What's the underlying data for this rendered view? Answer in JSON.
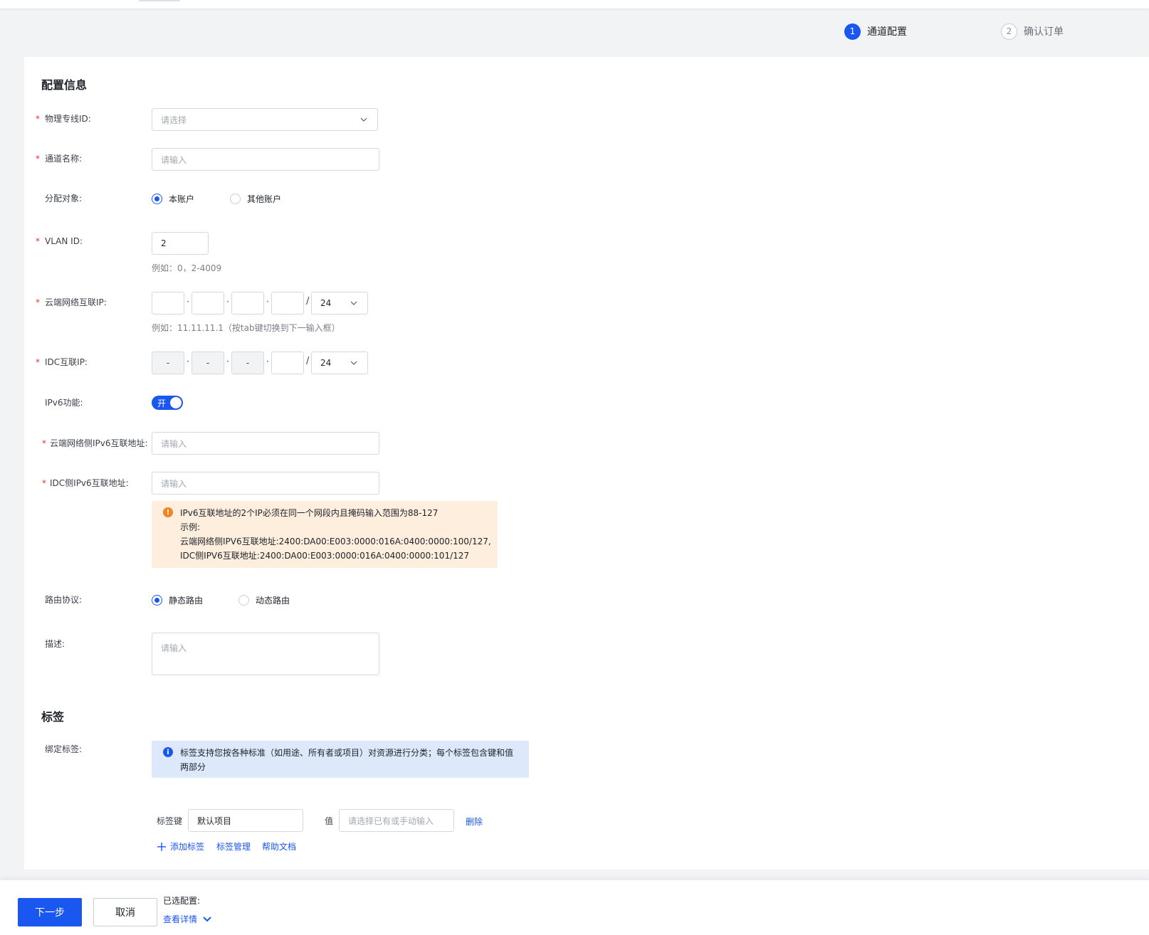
{
  "steps": [
    {
      "num": "1",
      "label": "通道配置"
    },
    {
      "num": "2",
      "label": "确认订单"
    }
  ],
  "config": {
    "title": "配置信息",
    "physical_line": {
      "label": "物理专线ID:",
      "placeholder": "请选择"
    },
    "channel_name": {
      "label": "通道名称:",
      "placeholder": "请输入"
    },
    "assign_target": {
      "label": "分配对象:",
      "options": [
        "本账户",
        "其他账户"
      ],
      "selected": "本账户"
    },
    "vlan": {
      "label": "VLAN ID:",
      "value": "2",
      "hint": "例如：0，2-4009"
    },
    "cloud_ip": {
      "label": "云端网络互联IP:",
      "octets": [
        "",
        "",
        "",
        ""
      ],
      "mask": "24",
      "hint": "例如：11.11.11.1（按tab键切换到下一输入框）"
    },
    "idc_ip": {
      "label": "IDC互联IP:",
      "octets": [
        "-",
        "-",
        "-",
        ""
      ],
      "mask": "24"
    },
    "ipv6": {
      "label": "IPv6功能:",
      "toggle_text": "开",
      "enabled": true
    },
    "cloud_ipv6": {
      "label": "云端网络侧IPv6互联地址:",
      "placeholder": "请输入"
    },
    "idc_ipv6": {
      "label": "IDC侧IPv6互联地址:",
      "placeholder": "请输入"
    },
    "ipv6_notice": {
      "lines": [
        "IPv6互联地址的2个IP必须在同一个网段内且掩码输入范围为88-127",
        "示例:",
        "云端网络侧IPV6互联地址:2400:DA00:E003:0000:016A:0400:0000:100/127,",
        "IDC侧IPV6互联地址:2400:DA00:E003:0000:016A:0400:0000:101/127"
      ]
    },
    "routing": {
      "label": "路由协议:",
      "options": [
        "静态路由",
        "动态路由"
      ],
      "selected": "静态路由"
    },
    "description": {
      "label": "描述:",
      "placeholder": "请输入"
    }
  },
  "tags": {
    "title": "标签",
    "bind_label": "绑定标签:",
    "info_lines": [
      "标签支持您按各种标准（如用途、所有者或项目）对资源进行分类；每个标签包含键和值",
      "两部分"
    ],
    "key_label": "标签键",
    "key_value": "默认项目",
    "value_label": "值",
    "value_placeholder": "请选择已有或手动输入",
    "delete": "删除",
    "add": "添加标签",
    "manage": "标签管理",
    "help": "帮助文档"
  },
  "footer": {
    "next": "下一步",
    "cancel": "取消",
    "selected_label": "已选配置:",
    "detail_link": "查看详情"
  },
  "colors": {
    "primary": "#1a56f0",
    "warning_bg": "#fdeedd",
    "info_bg": "#dde9fb",
    "required": "#e5372f"
  }
}
